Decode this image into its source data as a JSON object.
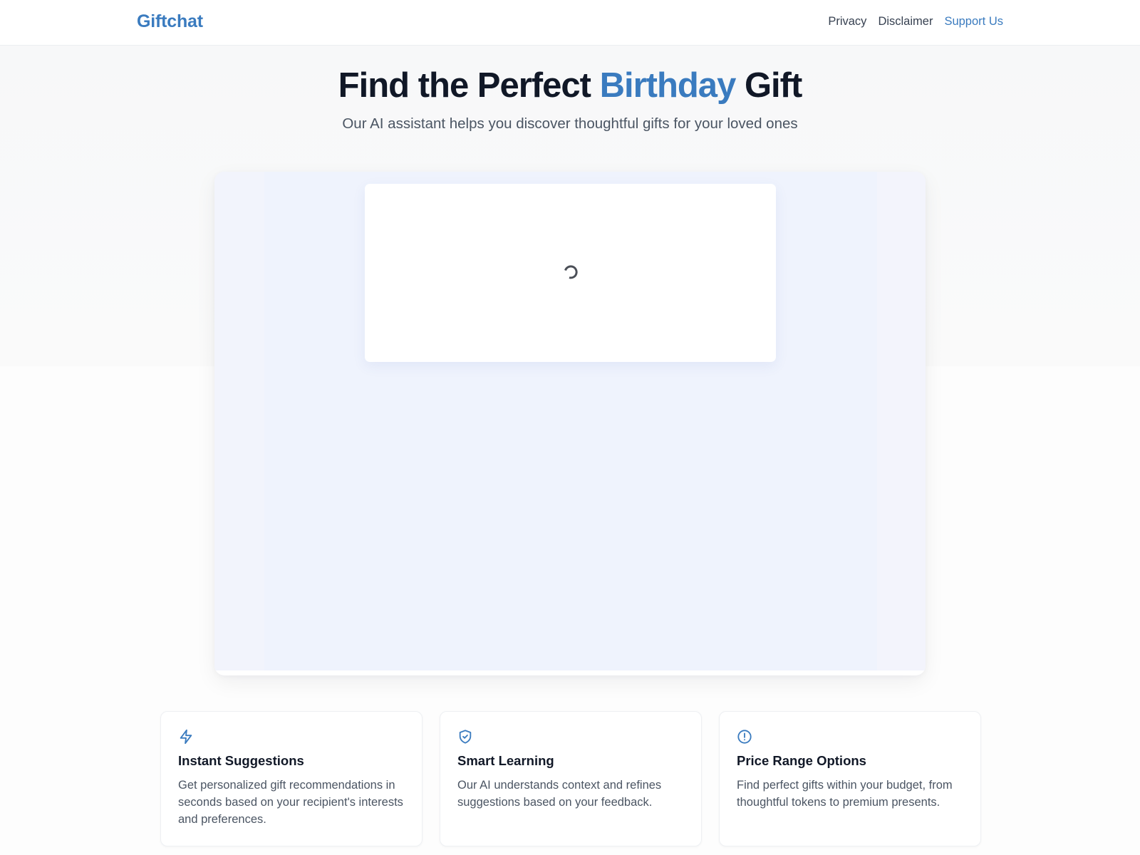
{
  "navbar": {
    "brand": "Giftchat",
    "links": [
      {
        "label": "Privacy"
      },
      {
        "label": "Disclaimer"
      },
      {
        "label": "Support Us",
        "accent": true
      }
    ]
  },
  "hero": {
    "title_before": "Find the Perfect ",
    "title_highlight": "Birthday",
    "title_after": " Gift",
    "subtitle": "Our AI assistant helps you discover thoughtful gifts for your loved ones"
  },
  "chat": {
    "state": "loading",
    "spinner_icon": "loading-spinner-icon"
  },
  "features": [
    {
      "icon": "lightning-bolt-icon",
      "title": "Instant Suggestions",
      "description": "Get personalized gift recommendations in seconds based on your recipient's interests and preferences."
    },
    {
      "icon": "shield-check-icon",
      "title": "Smart Learning",
      "description": "Our AI understands context and refines suggestions based on your feedback."
    },
    {
      "icon": "alert-circle-icon",
      "title": "Price Range Options",
      "description": "Find perfect gifts within your budget, from thoughtful tokens to premium presents."
    }
  ],
  "colors": {
    "accent": "#3a7bbf",
    "heading": "#111827",
    "body_text": "#4b5563",
    "chat_panel_bg": "#eff3fd"
  }
}
